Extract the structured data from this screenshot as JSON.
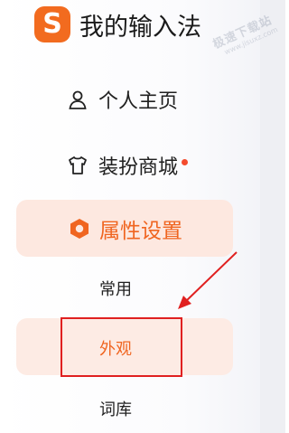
{
  "app": {
    "title": "我的输入法",
    "logo_glyph": "S",
    "logo_color": "#f26b1f"
  },
  "nav": {
    "profile": {
      "label": "个人主页",
      "icon": "user-icon"
    },
    "mall": {
      "label": "装扮商城",
      "icon": "tshirt-icon",
      "has_notification_dot": true
    }
  },
  "section": {
    "label": "属性设置",
    "icon": "hexagon-settings-icon",
    "selected": true,
    "accent_color": "#f06520",
    "sub_items": [
      {
        "label": "常用",
        "selected": false
      },
      {
        "label": "外观",
        "selected": true
      },
      {
        "label": "词库",
        "selected": false
      }
    ]
  },
  "annotation": {
    "highlight_color": "#e02020",
    "target": "外观"
  },
  "watermark": {
    "main": "极速下载站",
    "sub": "www.jisuxz.com"
  }
}
